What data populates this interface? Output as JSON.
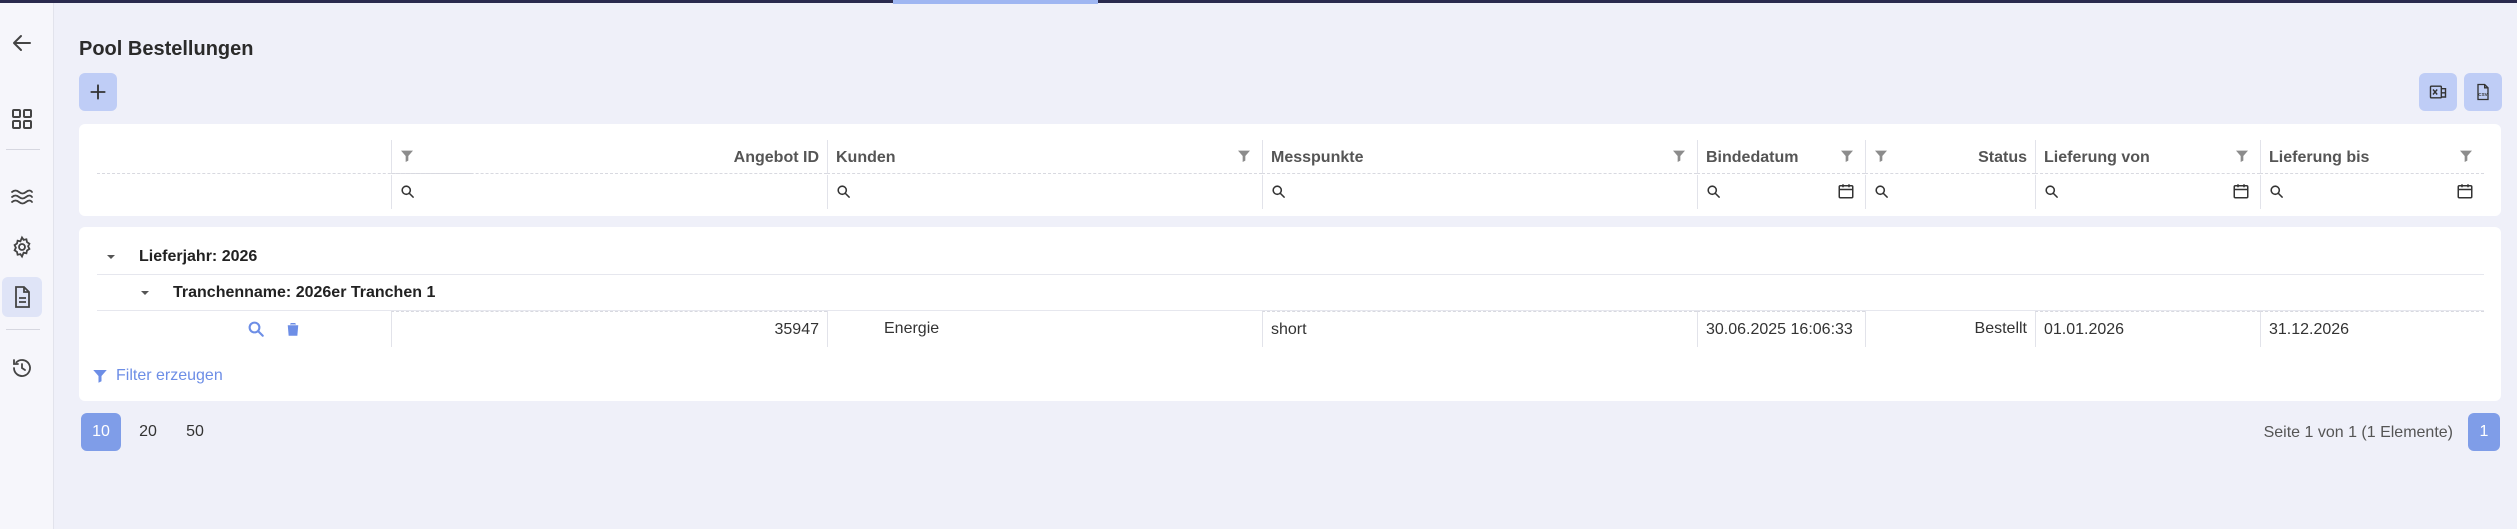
{
  "page": {
    "title": "Pool Bestellungen"
  },
  "icons": {
    "back": "arrow-left-icon",
    "dashboard": "grid-icon",
    "waves": "waves-icon",
    "settings": "gear-icon",
    "orders": "document-icon",
    "history": "history-icon",
    "add": "plus-icon",
    "export_excel": "excel-export-icon",
    "export_csv": "csv-export-icon",
    "filter": "funnel-icon",
    "search": "search-icon",
    "calendar": "calendar-icon",
    "chevron": "chevron-down-icon",
    "delete": "trash-icon"
  },
  "colors": {
    "accent": "#7f9de8",
    "button_bg": "#bfcdf6",
    "link": "#6d8ee6",
    "background": "#eff0f9"
  },
  "table": {
    "columns": [
      {
        "key": "angebot_id",
        "label": "Angebot ID"
      },
      {
        "key": "kunden",
        "label": "Kunden"
      },
      {
        "key": "messpunkte",
        "label": "Messpunkte"
      },
      {
        "key": "bindedatum",
        "label": "Bindedatum"
      },
      {
        "key": "status",
        "label": "Status"
      },
      {
        "key": "lieferung_von",
        "label": "Lieferung von"
      },
      {
        "key": "lieferung_bis",
        "label": "Lieferung bis"
      }
    ],
    "groups": [
      {
        "label": "Lieferjahr: 2026"
      },
      {
        "label": "Tranchenname: 2026er Tranchen 1"
      }
    ],
    "rows": [
      {
        "angebot_id": "35947",
        "kunden": "Energie",
        "messpunkte": "short",
        "bindedatum": "30.06.2025 16:06:33",
        "status": "Bestellt",
        "lieferung_von": "01.01.2026",
        "lieferung_bis": "31.12.2026"
      }
    ]
  },
  "filter_link": "Filter erzeugen",
  "pagination": {
    "sizes": [
      "10",
      "20",
      "50"
    ],
    "selected_size": "10",
    "info": "Seite 1 von 1 (1 Elemente)",
    "current_page": "1"
  }
}
